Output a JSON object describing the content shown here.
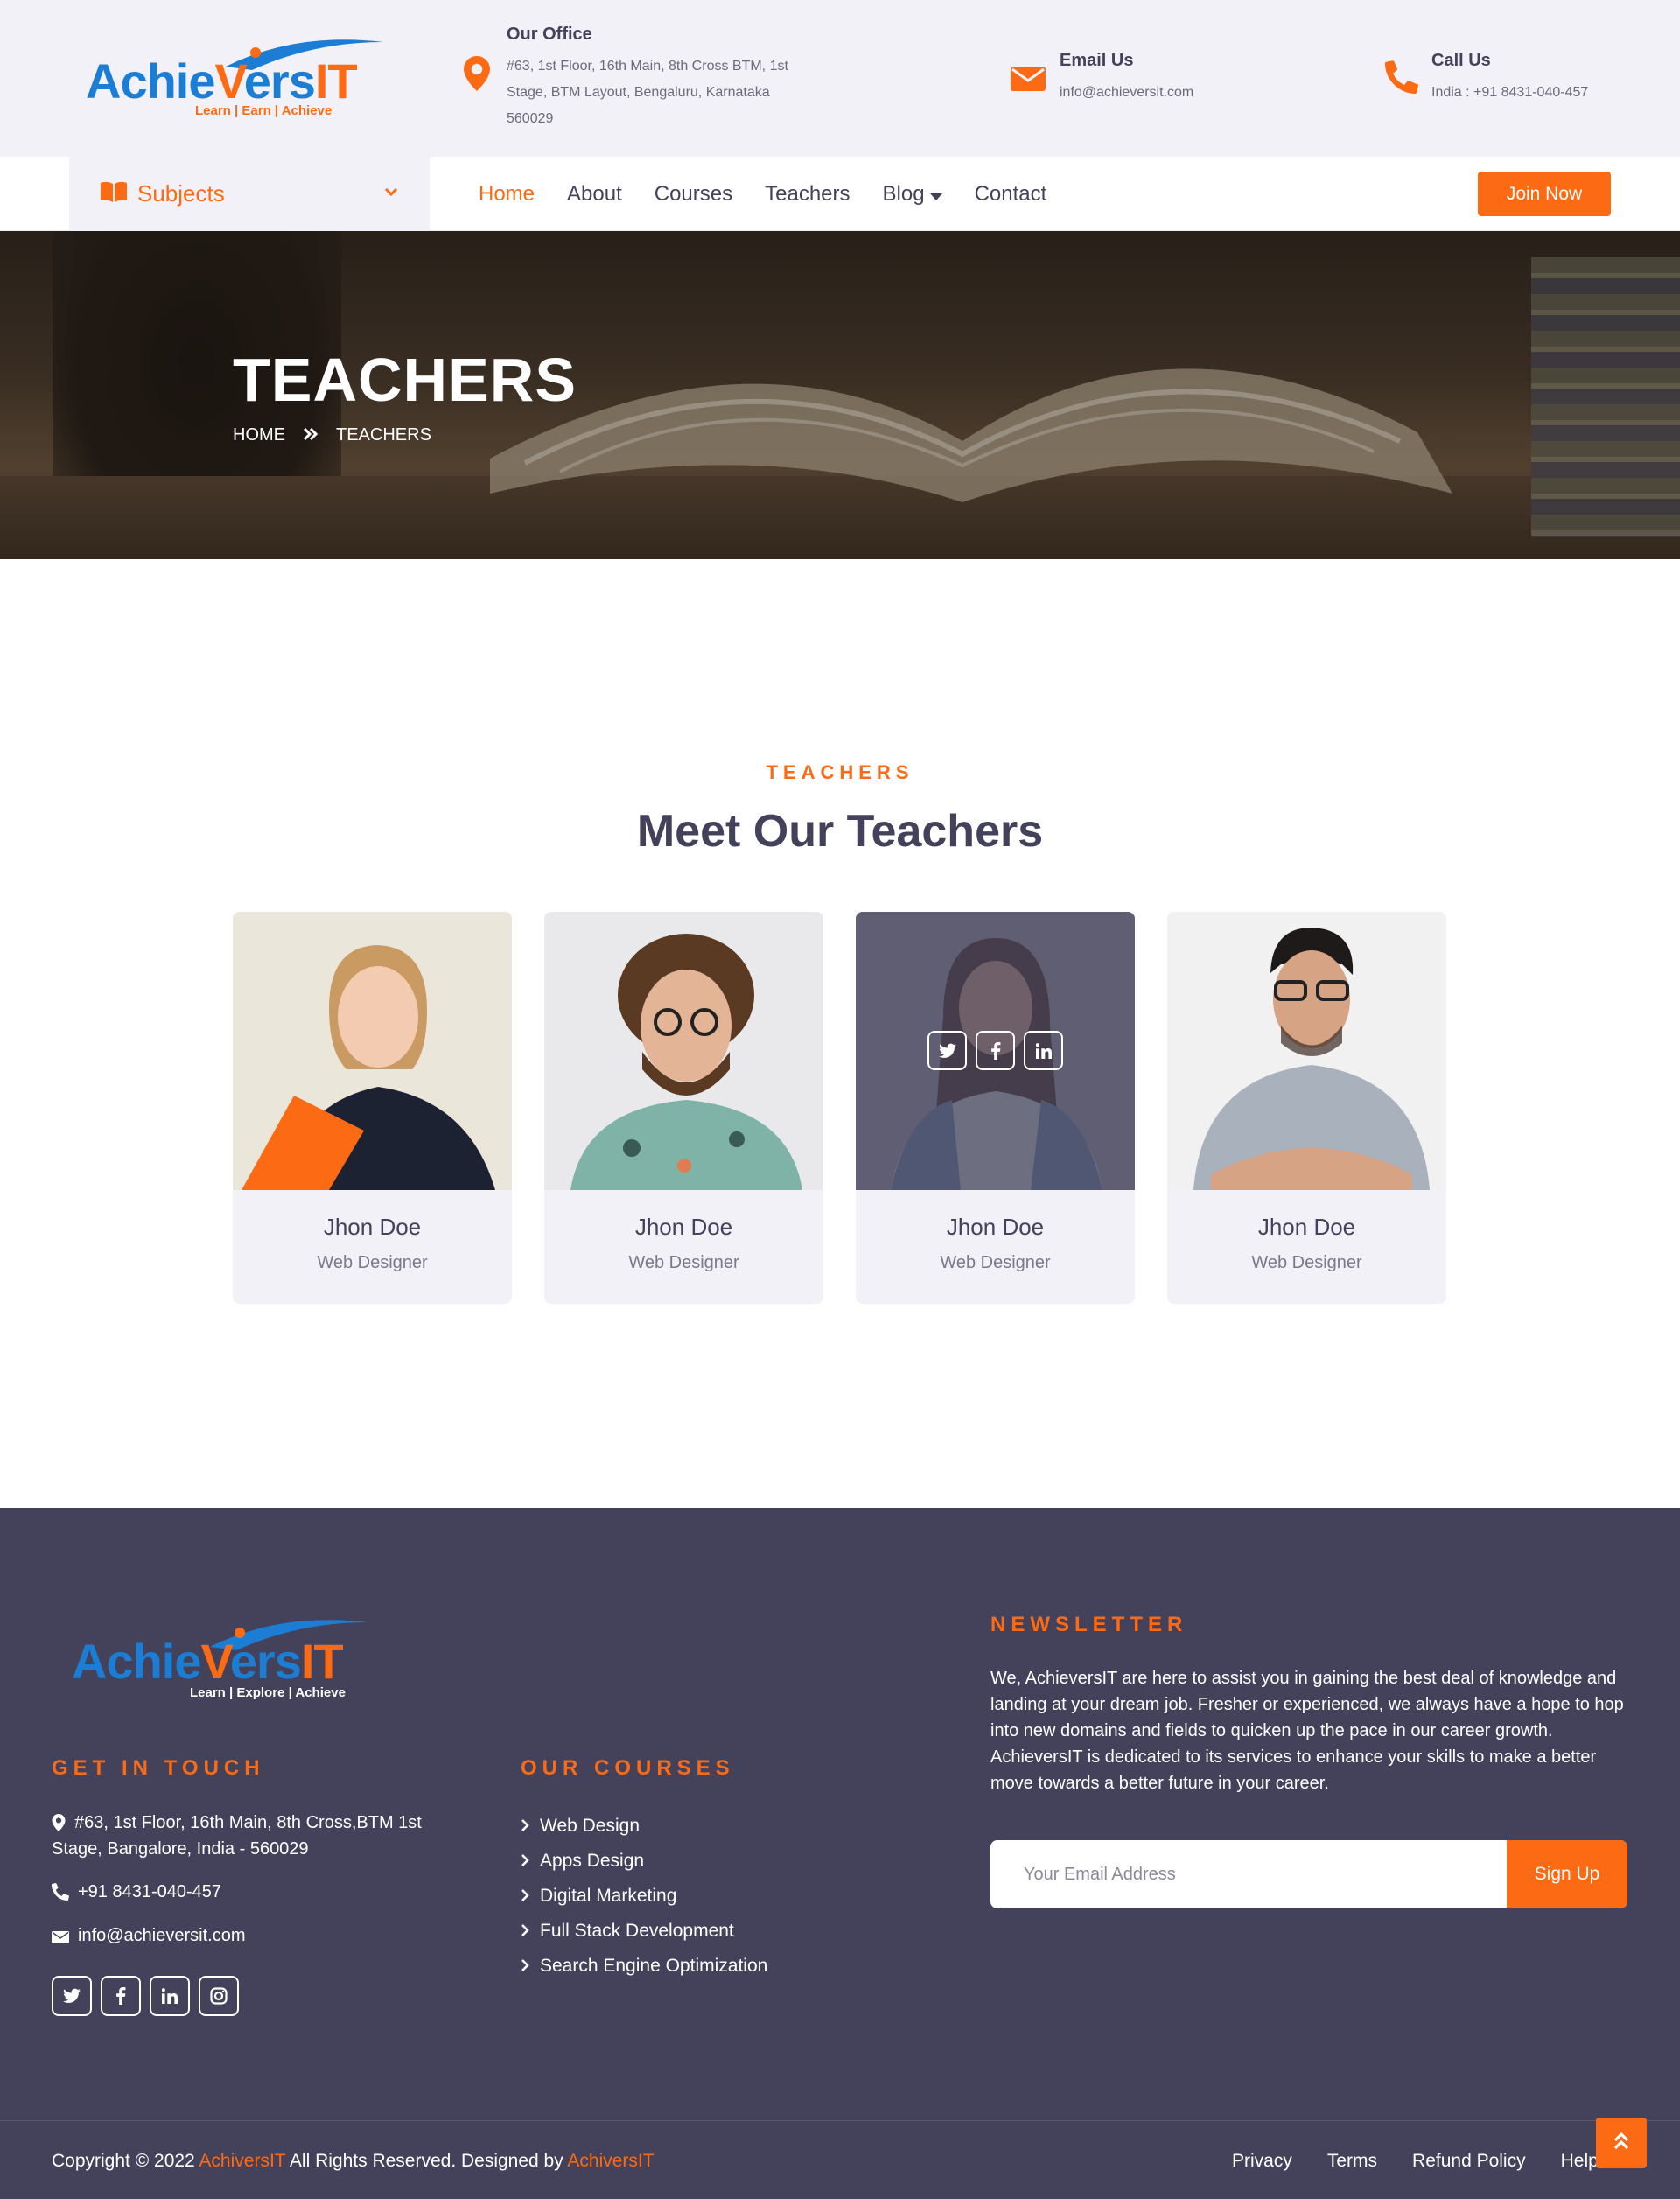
{
  "brand": {
    "name_a": "Achie",
    "name_b": "ers",
    "name_c": "IT",
    "tagline_header": "Learn | Earn | Achieve",
    "tagline_footer": "Learn | Explore | Achieve"
  },
  "header": {
    "office": {
      "title": "Our Office",
      "line1": "#63, 1st Floor, 16th Main, 8th Cross BTM, 1st",
      "line2": "Stage, BTM Layout, Bengaluru, Karnataka",
      "line3": "560029",
      "icon": "map-marker-icon"
    },
    "email": {
      "title": "Email Us",
      "value": "info@achieversit.com",
      "icon": "envelope-icon"
    },
    "phone": {
      "title": "Call Us",
      "value": "India : +91 8431-040-457",
      "icon": "phone-icon"
    }
  },
  "nav": {
    "subjects_label": "Subjects",
    "items": [
      "Home",
      "About",
      "Courses",
      "Teachers",
      "Blog",
      "Contact"
    ],
    "active": "Home",
    "join_label": "Join Now"
  },
  "hero": {
    "title": "TEACHERS",
    "breadcrumb": [
      "HOME",
      "TEACHERS"
    ]
  },
  "section": {
    "label": "TEACHERS",
    "title": "Meet Our Teachers"
  },
  "teachers": [
    {
      "name": "Jhon Doe",
      "role": "Web Designer"
    },
    {
      "name": "Jhon Doe",
      "role": "Web Designer"
    },
    {
      "name": "Jhon Doe",
      "role": "Web Designer"
    },
    {
      "name": "Jhon Doe",
      "role": "Web Designer"
    }
  ],
  "footer": {
    "get_in_touch": {
      "heading": "GET IN TOUCH",
      "address_line1": "#63, 1st Floor, 16th Main, 8th Cross,BTM 1st",
      "address_line2": "Stage, Bangalore, India - 560029",
      "phone": "+91 8431-040-457",
      "email": "info@achieversit.com"
    },
    "courses": {
      "heading": "OUR COURSES",
      "items": [
        "Web Design",
        "Apps Design",
        "Digital Marketing",
        "Full Stack Development",
        "Search Engine Optimization"
      ]
    },
    "newsletter": {
      "heading": "NEWSLETTER",
      "text": "We, AchieversIT are here to assist you in gaining the best deal of knowledge and landing at your dream job. Fresher or experienced, we always have a hope to hop into new domains and fields to quicken up the pace in our career growth. AchieversIT is dedicated to its services to enhance your skills to make a better move towards a better future in your career.",
      "placeholder": "Your Email Address",
      "button": "Sign Up"
    },
    "copyright": {
      "prefix": "Copyright © 2022 ",
      "brand": "AchiversIT",
      "middle": " All Rights Reserved. Designed by ",
      "designer": "AchiversIT"
    },
    "links": [
      "Privacy",
      "Terms",
      "Refund Policy",
      "Help"
    ]
  },
  "colors": {
    "accent": "#fd6a14",
    "brand_blue": "#1b7ed4",
    "dark": "#44425a",
    "light_bg": "#f2f1f8"
  }
}
